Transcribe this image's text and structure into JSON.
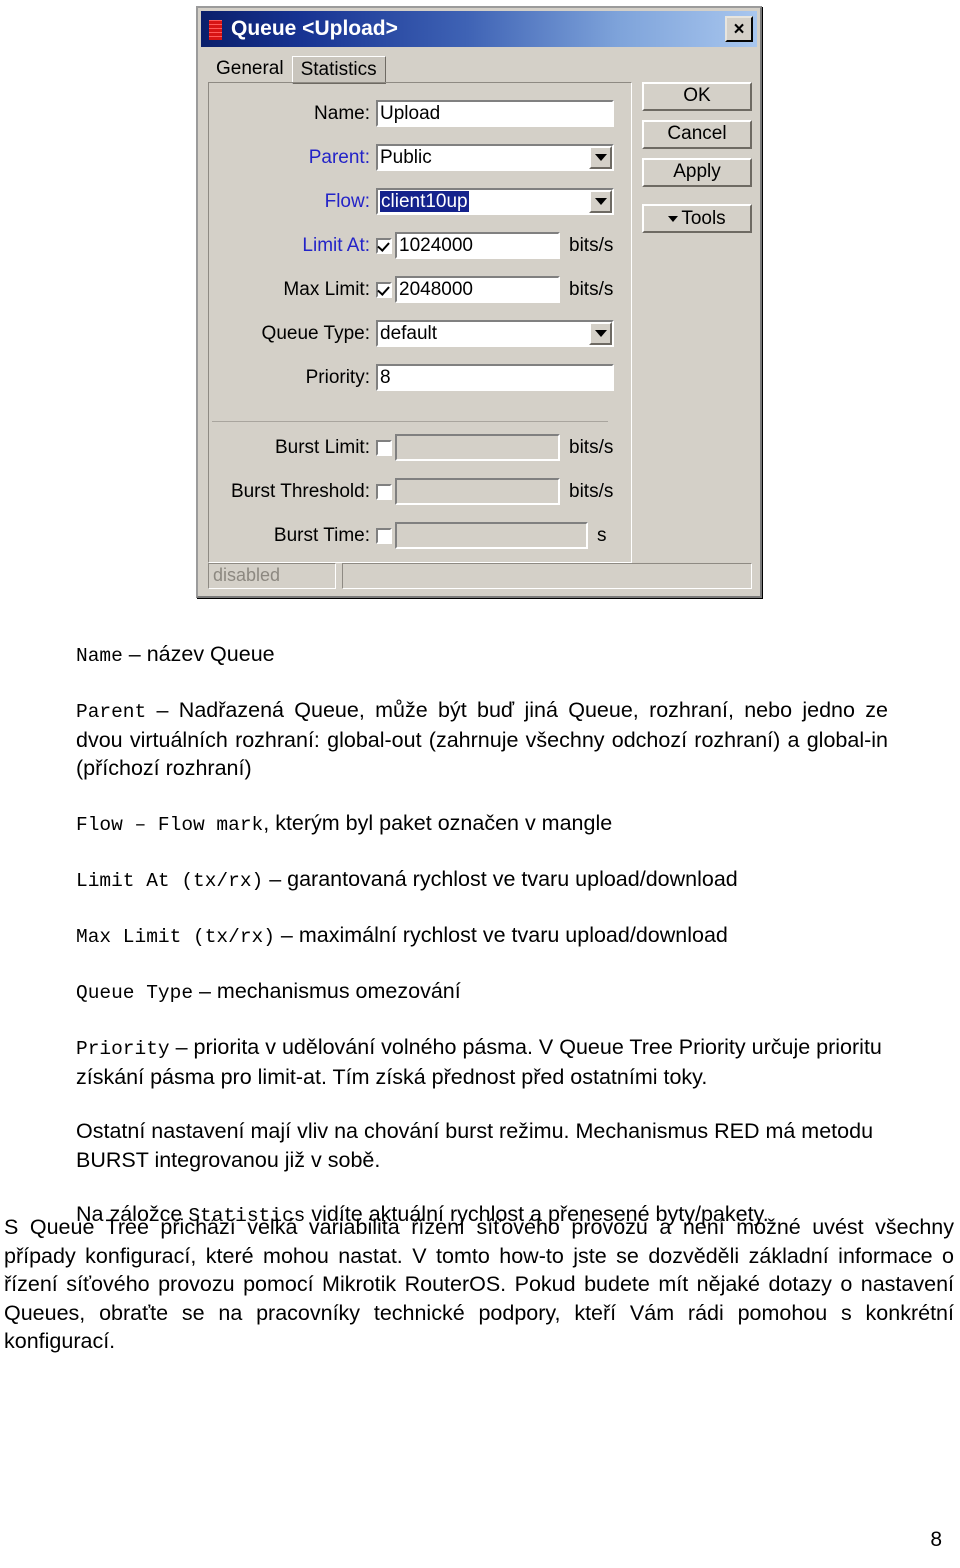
{
  "dialog": {
    "icon": "queue-stack-icon",
    "title": "Queue <Upload>",
    "close_label": "×",
    "tabs": [
      {
        "label": "General",
        "active": true
      },
      {
        "label": "Statistics",
        "active": false
      }
    ],
    "fields": {
      "name": {
        "label": "Name:",
        "value": "Upload"
      },
      "parent": {
        "label": "Parent:",
        "value": "Public"
      },
      "flow": {
        "label": "Flow:",
        "value": "client10up"
      },
      "limit_at": {
        "label": "Limit At:",
        "value": "1024000",
        "unit": "bits/s",
        "checked": true
      },
      "max_limit": {
        "label": "Max Limit:",
        "value": "2048000",
        "unit": "bits/s",
        "checked": true
      },
      "queue_type": {
        "label": "Queue Type:",
        "value": "default"
      },
      "priority": {
        "label": "Priority:",
        "value": "8"
      },
      "burst_limit": {
        "label": "Burst Limit:",
        "value": "",
        "unit": "bits/s",
        "checked": false
      },
      "burst_threshold": {
        "label": "Burst Threshold:",
        "value": "",
        "unit": "bits/s",
        "checked": false
      },
      "burst_time": {
        "label": "Burst Time:",
        "value": "",
        "unit": "s",
        "checked": false
      }
    },
    "buttons": {
      "ok": "OK",
      "cancel": "Cancel",
      "apply": "Apply",
      "tools": "Tools"
    },
    "statusbar": {
      "left": "disabled",
      "right": ""
    },
    "colors": {
      "title_start": "#0a1f6b",
      "title_end": "#a8c6ee",
      "face": "#d4d0c8",
      "link_label": "#2323c8",
      "selection": "#14228c"
    }
  },
  "doc": {
    "p1": {
      "term": "Name",
      "text": " – název Queue"
    },
    "p2": {
      "term": "Parent",
      "text": " – Nadřazená Queue, může být buď jiná Queue, rozhraní, nebo jedno ze dvou virtuálních rozhraní: global-out (zahrnuje všechny odchozí rozhraní) a global-in (příchozí rozhraní)"
    },
    "p3": {
      "term": "Flow",
      "term2": "Flow mark",
      "dash": " – ",
      "text": ", kterým byl paket označen v mangle"
    },
    "p4": {
      "term": "Limit At (tx/rx)",
      "text": " – garantovaná rychlost ve tvaru upload/download"
    },
    "p5": {
      "term": "Max Limit (tx/rx)",
      "text": " – maximální rychlost ve tvaru upload/download"
    },
    "p6": {
      "term": "Queue Type",
      "text": " – mechanismus omezování"
    },
    "p7": {
      "term": "Priority",
      "text": " – priorita v udělování volného pásma. V Queue Tree Priority určuje prioritu získání pásma pro limit-at. Tím získá přednost před ostatními toky."
    },
    "p8": {
      "text": "Ostatní nastavení mají vliv na chování burst režimu. Mechanismus RED má metodu BURST integrovanou již v sobě."
    },
    "p9": {
      "pre": "Na záložce ",
      "term": "Statistics",
      "text": " vidíte aktuální rychlost a přenesené byty/pakety."
    },
    "p10": {
      "text": "S Queue Tree přichází velká variabilita řízení síťového provozu a není možné uvést všechny případy konfigurací, které mohou nastat. V tomto how-to jste se dozvěděli základní informace o řízení síťového provozu pomocí Mikrotik RouterOS. Pokud budete mít nějaké dotazy o nastavení Queues, obraťte se na pracovníky technické podpory, kteří Vám rádi pomohou s konkrétní konfigurací."
    },
    "page_number": "8"
  }
}
